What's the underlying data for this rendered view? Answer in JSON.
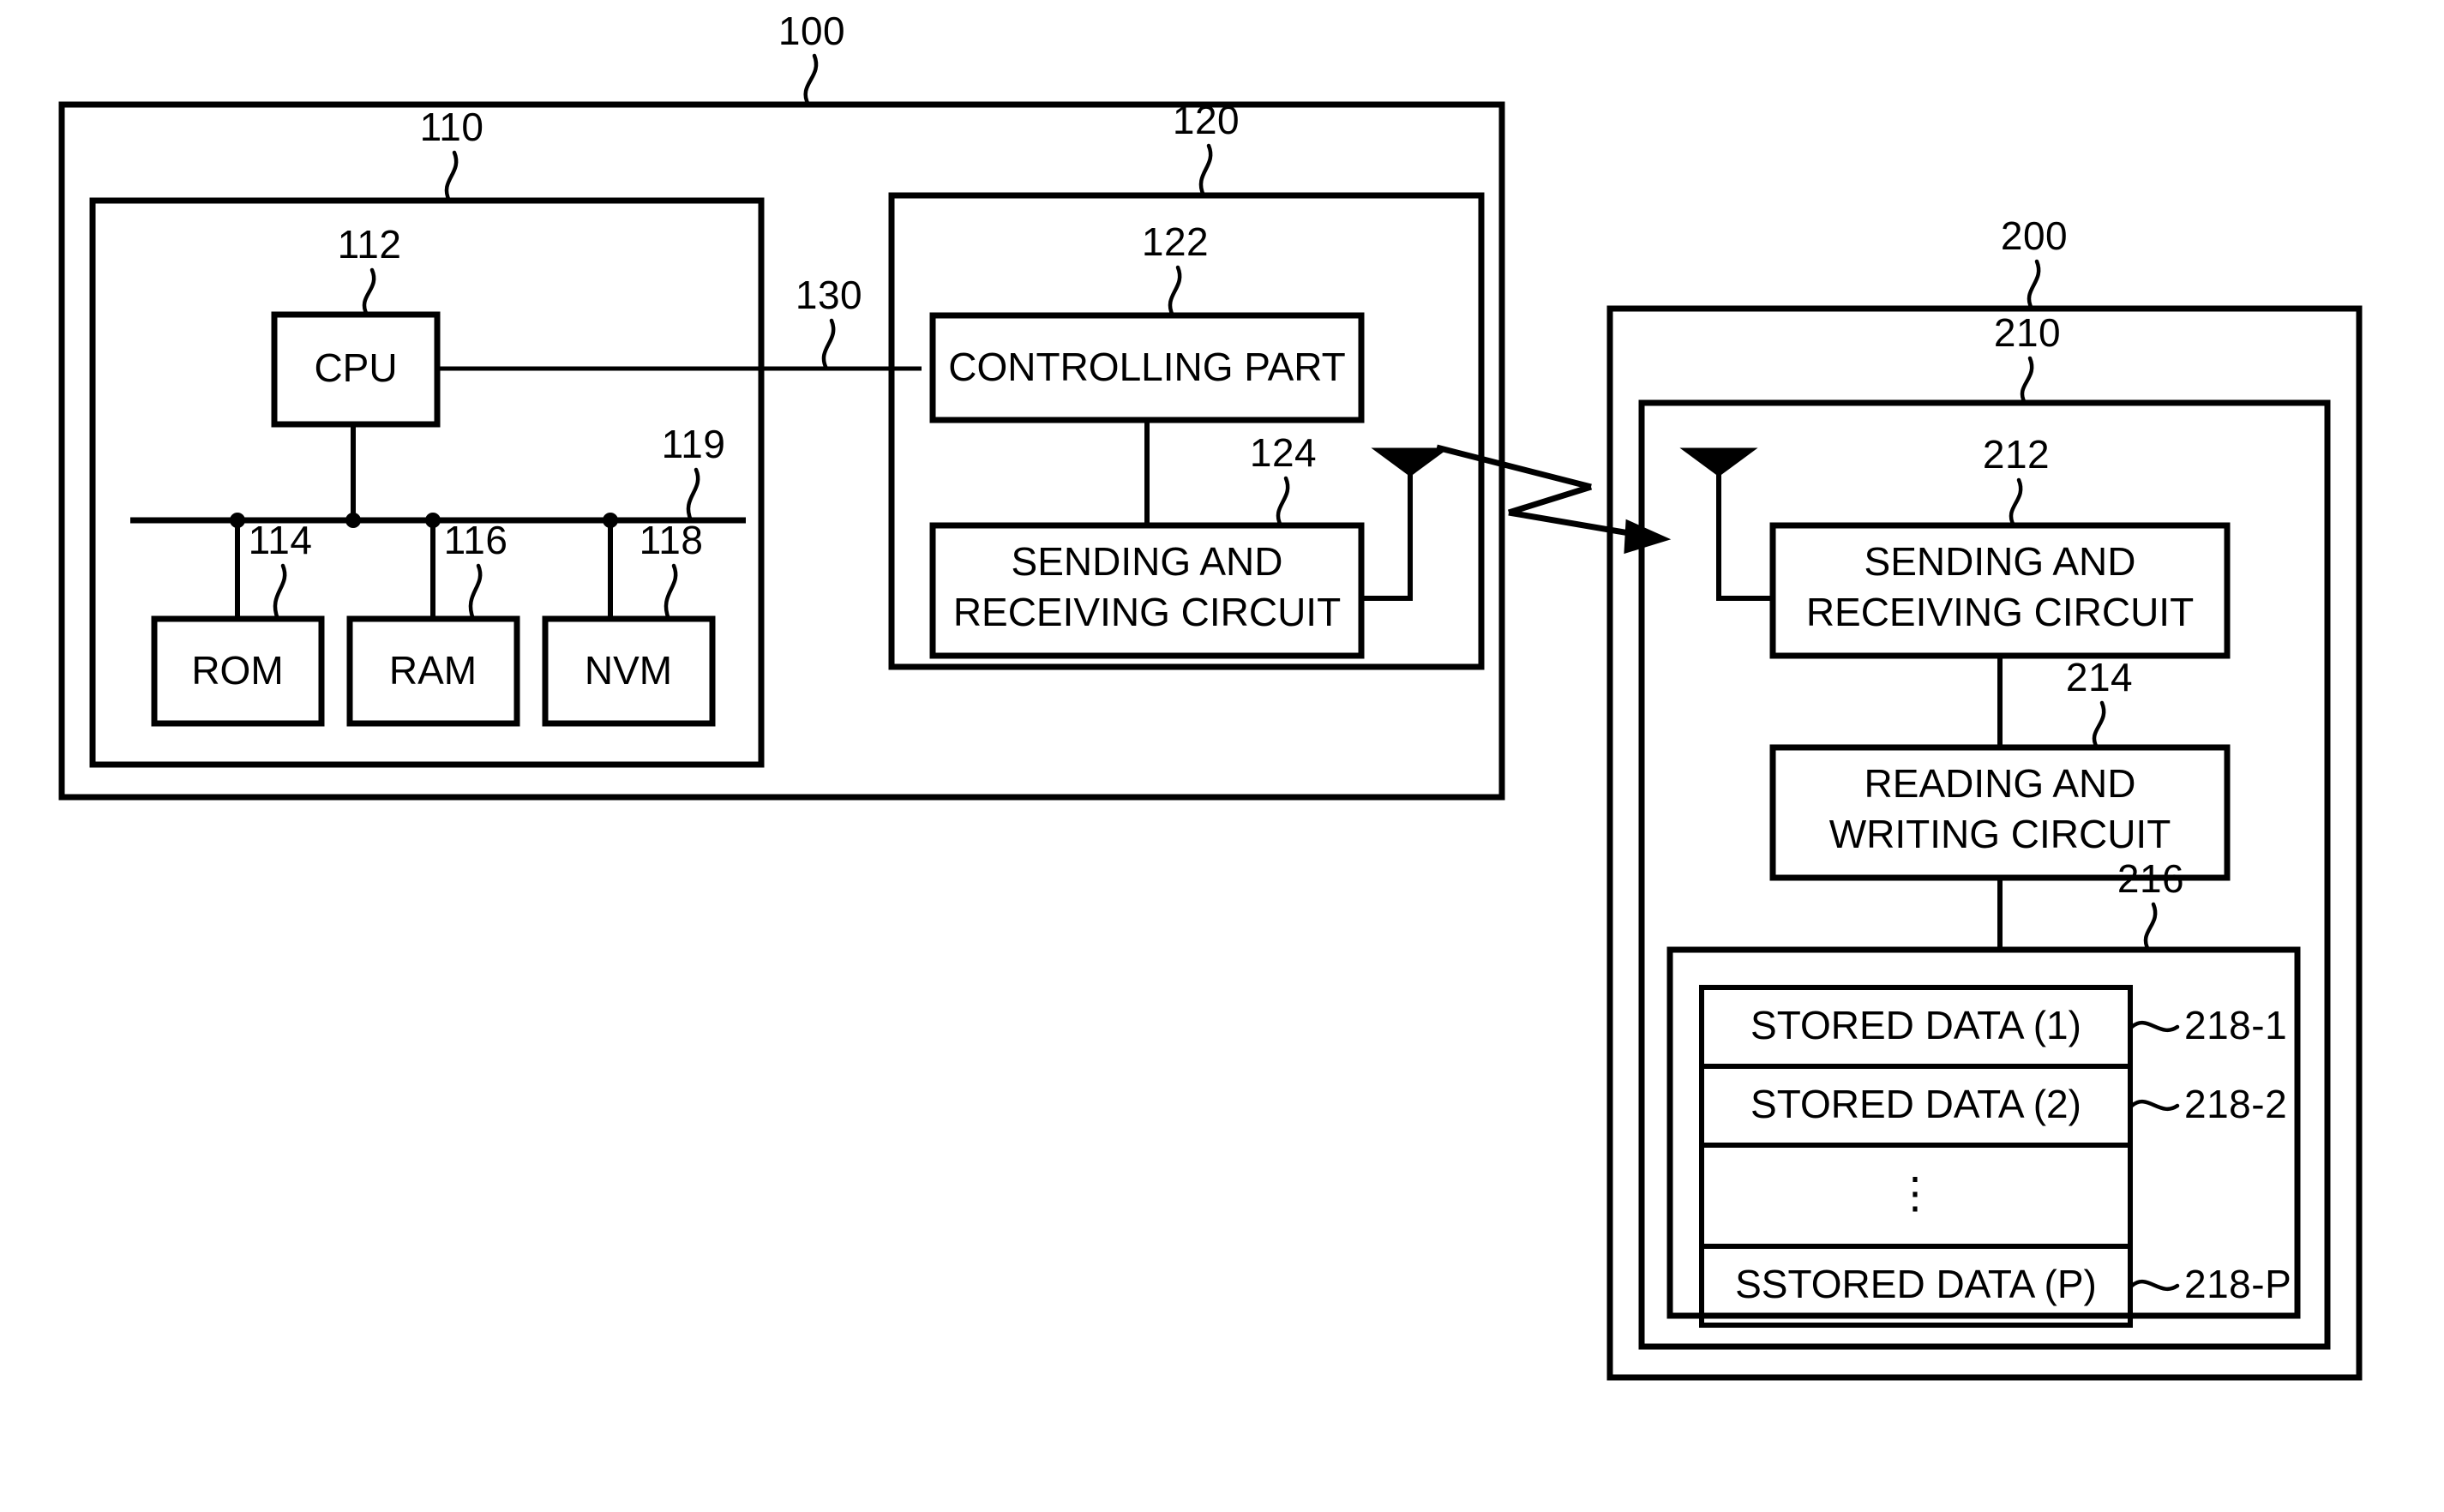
{
  "figure": {
    "type": "patent-block-diagram",
    "description": "Wireless communication system block diagram with reader/writer apparatus (100) and responder tag (200)"
  },
  "blocks": {
    "system_100": {
      "ref": "100",
      "label": ""
    },
    "controller_unit_110": {
      "ref": "110",
      "label": ""
    },
    "cpu_112": {
      "ref": "112",
      "label": "CPU"
    },
    "rom_114": {
      "ref": "114",
      "label": "ROM"
    },
    "ram_116": {
      "ref": "116",
      "label": "RAM"
    },
    "nvm_118": {
      "ref": "118",
      "label": "NVM"
    },
    "bus_119": {
      "ref": "119",
      "label": ""
    },
    "comm_unit_120": {
      "ref": "120",
      "label": ""
    },
    "controlling_part_122": {
      "ref": "122",
      "label": "CONTROLLING PART"
    },
    "sending_receiving_circuit_124": {
      "ref": "124",
      "line1": "SENDING AND",
      "line2": "RECEIVING CIRCUIT"
    },
    "interface_130": {
      "ref": "130",
      "label": ""
    },
    "tag_200": {
      "ref": "200",
      "label": ""
    },
    "tag_inner_210": {
      "ref": "210",
      "label": ""
    },
    "sending_receiving_circuit_212": {
      "ref": "212",
      "line1": "SENDING AND",
      "line2": "RECEIVING CIRCUIT"
    },
    "reading_writing_circuit_214": {
      "ref": "214",
      "line1": "READING AND",
      "line2": "WRITING CIRCUIT"
    },
    "memory_216": {
      "ref": "216",
      "label": ""
    }
  },
  "stored_data": {
    "rows": [
      {
        "label": "STORED DATA (1)",
        "ref": "218-1"
      },
      {
        "label": "STORED DATA (2)",
        "ref": "218-2"
      },
      {
        "label": "",
        "ref": ""
      },
      {
        "label": "SSTORED DATA (P)",
        "ref": "218-P"
      }
    ],
    "ellipsis": "⋮"
  },
  "icons": {
    "antenna_transmit": "antenna-icon",
    "antenna_receive": "antenna-icon",
    "wireless_link": "wireless-link-arrow-icon"
  },
  "colors": {
    "ink": "#000000",
    "paper": "#ffffff"
  }
}
